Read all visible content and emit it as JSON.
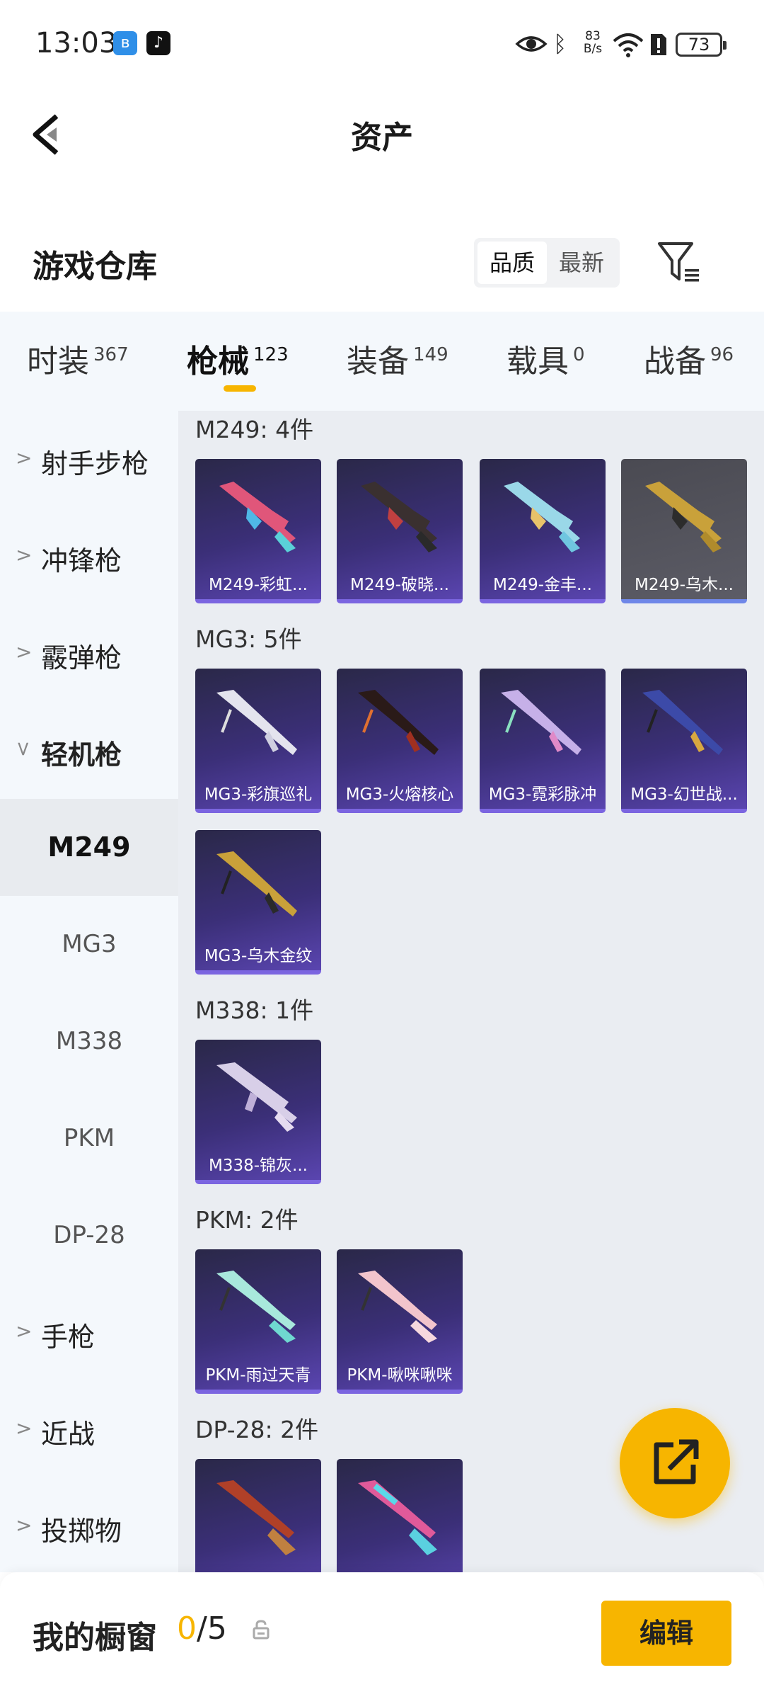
{
  "status_bar": {
    "time": "13:03",
    "net_speed_value": "83",
    "net_speed_unit": "B/s",
    "battery": "73"
  },
  "header": {
    "title": "资产",
    "back_icon": "back-arrow-icon"
  },
  "warehouse": {
    "title": "游戏仓库",
    "sort_options": [
      "品质",
      "最新"
    ],
    "selected_sort": "品质",
    "filter_icon": "filter-icon"
  },
  "tabs": [
    {
      "label": "时装",
      "count": "367"
    },
    {
      "label": "枪械",
      "count": "123",
      "active": true
    },
    {
      "label": "装备",
      "count": "149"
    },
    {
      "label": "载具",
      "count": "0"
    },
    {
      "label": "战备",
      "count": "96"
    }
  ],
  "sidebar": {
    "categories": [
      "射手步枪",
      "冲锋枪",
      "霰弹枪",
      "轻机枪",
      "手枪",
      "近战",
      "投掷物"
    ],
    "expanded": "轻机枪",
    "sub_items": [
      "M249",
      "MG3",
      "M338",
      "PKM",
      "DP-28"
    ],
    "selected_sub": "M249"
  },
  "groups": [
    {
      "label": "M249: 4件",
      "items": [
        "M249-彩虹...",
        "M249-破晓...",
        "M249-金丰...",
        "M249-乌木..."
      ]
    },
    {
      "label": "MG3: 5件",
      "items": [
        "MG3-彩旗巡礼",
        "MG3-火熔核心",
        "MG3-霓彩脉冲",
        "MG3-幻世战...",
        "MG3-乌木金纹"
      ]
    },
    {
      "label": "M338: 1件",
      "items": [
        "M338-锦灰..."
      ]
    },
    {
      "label": "PKM: 2件",
      "items": [
        "PKM-雨过天青",
        "PKM-啾咪啾咪"
      ]
    },
    {
      "label": "DP-28: 2件",
      "items": [
        "",
        ""
      ]
    }
  ],
  "colors": {
    "accent": "#f7b500",
    "card_bg": "#3b2f78",
    "card_border": "#7b65e0"
  },
  "fab": {
    "icon": "share-external-icon"
  },
  "bottom_bar": {
    "title": "我的橱窗",
    "used": "0",
    "total": "/5",
    "lock_icon": "lock-icon",
    "edit_label": "编辑"
  }
}
